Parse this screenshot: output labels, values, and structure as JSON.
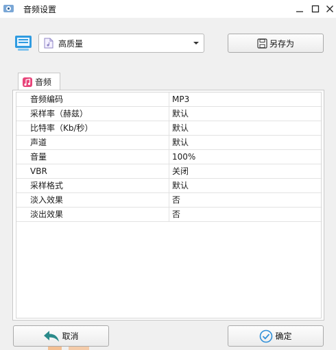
{
  "window": {
    "title": "音频设置"
  },
  "preset": {
    "selected": "高质量"
  },
  "toolbar": {
    "save_as_label": "另存为"
  },
  "tabs": [
    {
      "label": "音频"
    }
  ],
  "settings": [
    {
      "key": "音频编码",
      "value": "MP3"
    },
    {
      "key": "采样率（赫兹）",
      "value": "默认"
    },
    {
      "key": "比特率（Kb/秒）",
      "value": "默认"
    },
    {
      "key": "声道",
      "value": "默认"
    },
    {
      "key": "音量",
      "value": "100%"
    },
    {
      "key": "VBR",
      "value": "关闭"
    },
    {
      "key": "采样格式",
      "value": "默认"
    },
    {
      "key": "淡入效果",
      "value": "否"
    },
    {
      "key": "淡出效果",
      "value": "否"
    }
  ],
  "footer": {
    "cancel_label": "取消",
    "ok_label": "确定"
  },
  "colors": {
    "accent_blue": "#1e90d8",
    "tab_icon_pink": "#e8457a",
    "ok_check": "#2f8fd8",
    "cancel_arrow": "#2a8a8a"
  }
}
